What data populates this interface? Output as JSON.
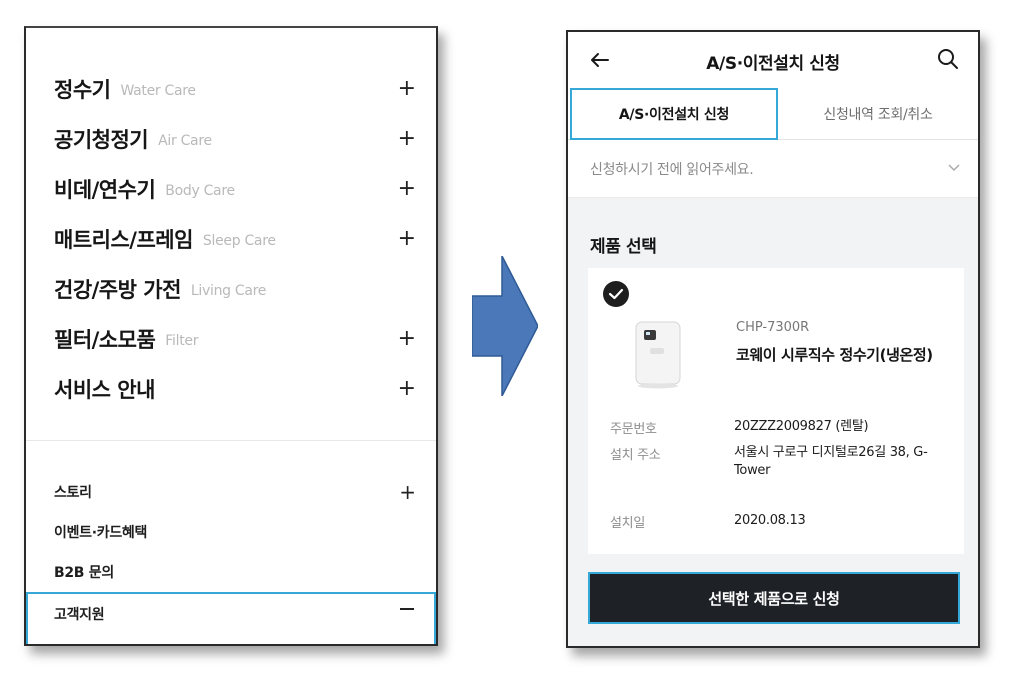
{
  "left_menu": {
    "items": [
      {
        "title": "정수기",
        "subtitle": "Water Care",
        "expand": "+"
      },
      {
        "title": "공기청정기",
        "subtitle": "Air Care",
        "expand": "+"
      },
      {
        "title": "비데/연수기",
        "subtitle": "Body Care",
        "expand": "+"
      },
      {
        "title": "매트리스/프레임",
        "subtitle": "Sleep Care",
        "expand": "+"
      },
      {
        "title": "건강/주방 가전",
        "subtitle": "Living Care",
        "expand": ""
      },
      {
        "title": "필터/소모품",
        "subtitle": "Filter",
        "expand": "+"
      },
      {
        "title": "서비스 안내",
        "subtitle": "",
        "expand": "+"
      }
    ],
    "sub_items": [
      {
        "title": "스토리",
        "expand": "+"
      },
      {
        "title": "이벤트·카드혜택",
        "expand": ""
      },
      {
        "title": "B2B 문의",
        "expand": ""
      },
      {
        "title": "고객지원",
        "expand": "−"
      }
    ]
  },
  "mobile": {
    "header": {
      "title": "A/S·이전설치 신청",
      "back_icon": "arrow-left-icon",
      "search_icon": "search-icon"
    },
    "tabs": [
      {
        "label": "A/S·이전설치 신청",
        "active": true
      },
      {
        "label": "신청내역 조회/취소",
        "active": false
      }
    ],
    "notice": "신청하시기 전에 읽어주세요.",
    "section_title": "제품 선택",
    "product": {
      "model": "CHP-7300R",
      "name": "코웨이 시루직수 정수기(냉온정)",
      "order_label": "주문번호",
      "order_value": "20ZZZ2009827 (렌탈)",
      "address_label": "설치 주소",
      "address_value": "서울시 구로구 디지털로26길 38, G-Tower",
      "date_label": "설치일",
      "date_value": "2020.08.13"
    },
    "submit_label": "선택한 제품으로 신청"
  },
  "colors": {
    "highlight": "#34a9d8",
    "arrow": "#4a78b8",
    "button": "#1e2227"
  }
}
